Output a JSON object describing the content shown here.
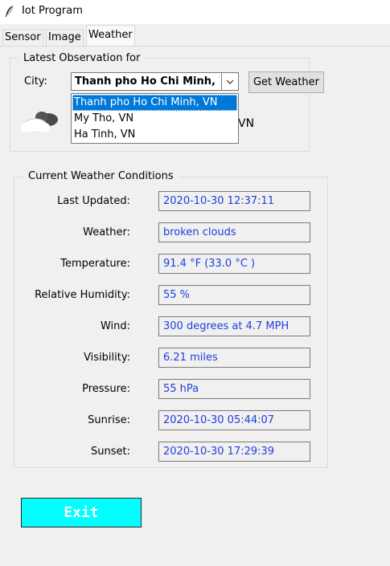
{
  "window": {
    "title": "Iot Program",
    "icon": "feather-icon"
  },
  "tabs": [
    {
      "label": "Sensor"
    },
    {
      "label": "Image"
    },
    {
      "label": "Weather"
    }
  ],
  "observation": {
    "group_title": "Latest Observation for",
    "city_label": "City:",
    "city_selected": "Thanh pho Ho Chi Minh, VN",
    "get_weather_label": "Get Weather",
    "options": [
      "Thanh pho Ho Chi Minh, VN",
      "My Tho, VN",
      "Ha Tinh, VN"
    ],
    "location_tail": "VN",
    "weather_icon": "broken-clouds-icon"
  },
  "conditions": {
    "group_title": "Current Weather Conditions",
    "fields": [
      {
        "label": "Last Updated:",
        "value": "2020-10-30  12:37:11"
      },
      {
        "label": "Weather:",
        "value": "broken clouds"
      },
      {
        "label": "Temperature:",
        "value": "91.4 °F  (33.0 °C )"
      },
      {
        "label": "Relative Humidity:",
        "value": "55 %"
      },
      {
        "label": "Wind:",
        "value": "300 degrees at 4.7 MPH"
      },
      {
        "label": "Visibility:",
        "value": "6.21 miles"
      },
      {
        "label": "Pressure:",
        "value": "55 hPa"
      },
      {
        "label": "Sunrise:",
        "value": "2020-10-30  05:44:07"
      },
      {
        "label": "Sunset:",
        "value": "2020-10-30  17:29:39"
      }
    ]
  },
  "exit_label": "Exit",
  "colors": {
    "value_text": "#1f3fdd",
    "exit_bg": "#00ffff",
    "selection": "#0078d7"
  }
}
